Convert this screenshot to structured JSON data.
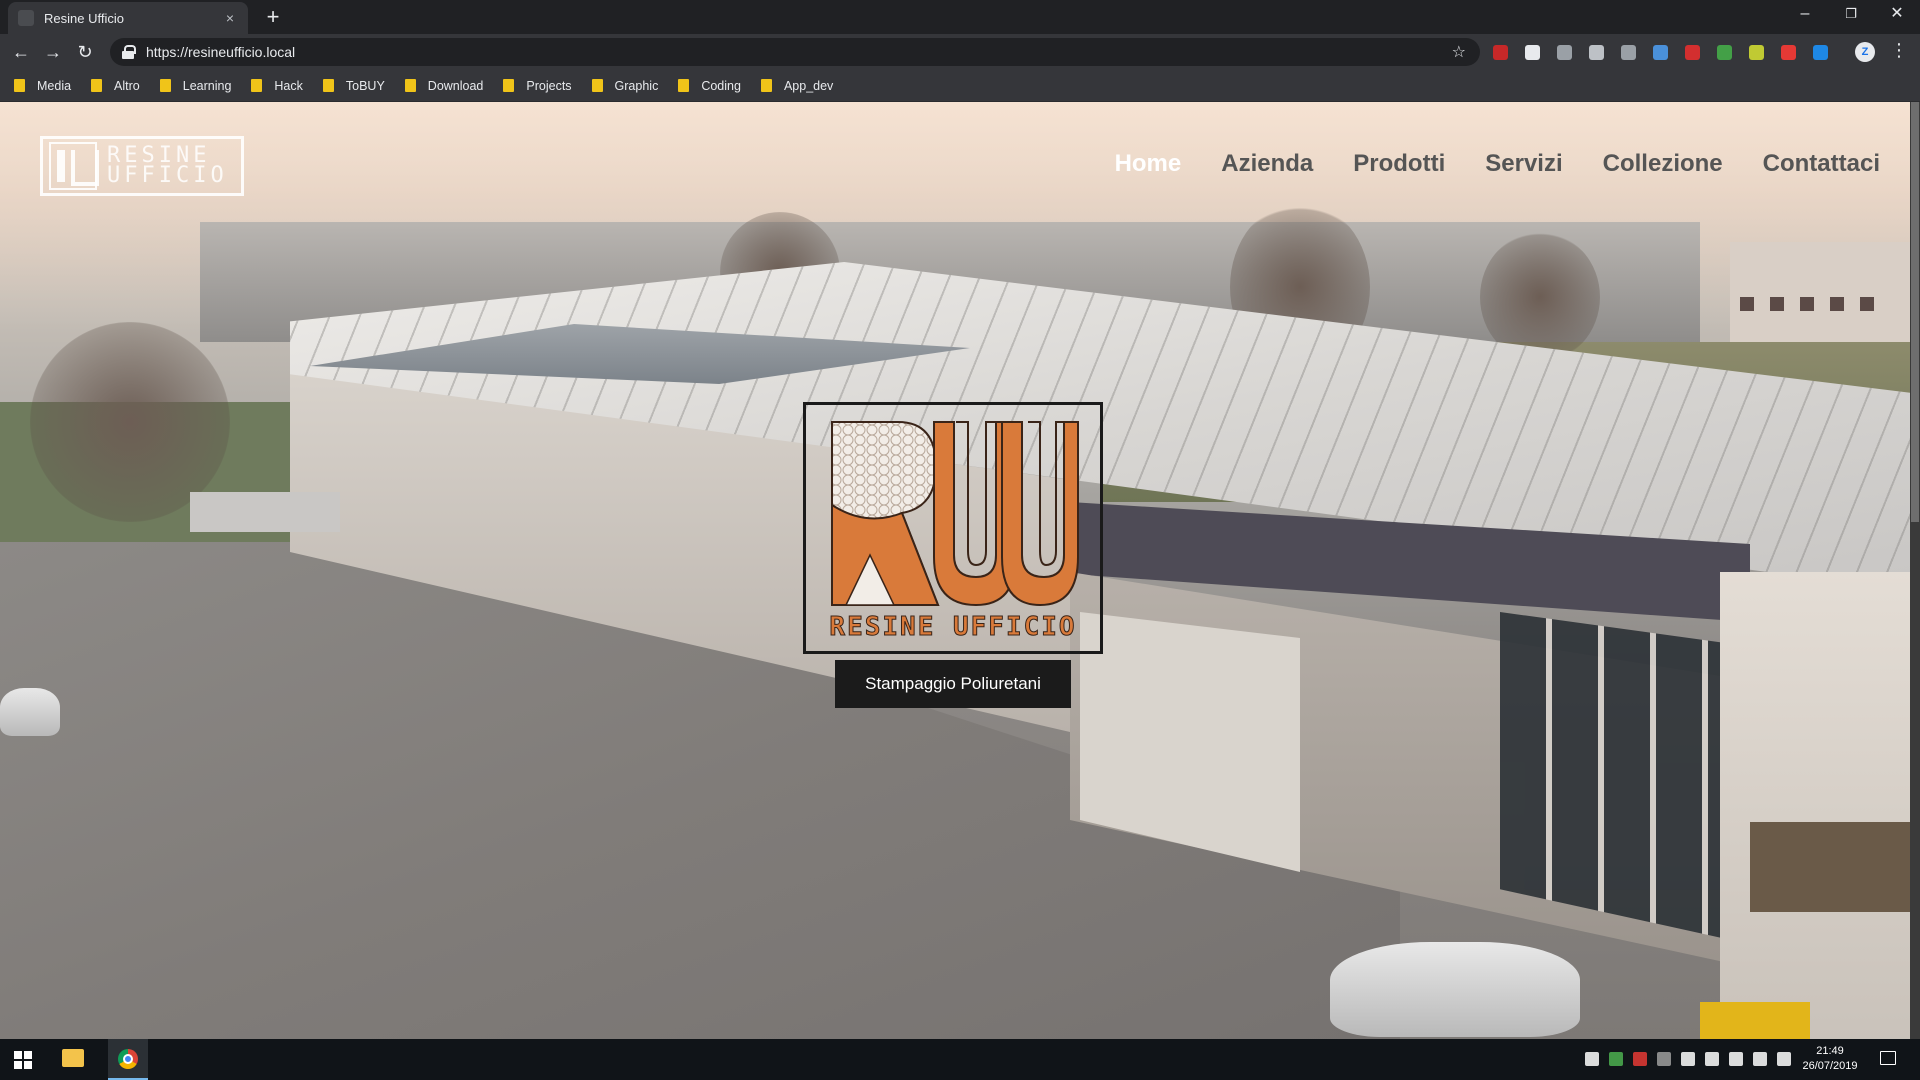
{
  "browser": {
    "tab_title": "Resine Ufficio",
    "tab_close": "×",
    "new_tab": "+",
    "url": "https://resineufficio.local",
    "window_controls": {
      "minimize": "–",
      "restore": "❐",
      "close": "✕"
    },
    "nav": {
      "back": "←",
      "forward": "→",
      "reload": "↻"
    },
    "bookmark_star": "☆",
    "profile_initial": "Z",
    "menu": "⋮",
    "bookmarks": [
      "Media",
      "Altro",
      "Learning",
      "Hack",
      "ToBUY",
      "Download",
      "Projects",
      "Graphic",
      "Coding",
      "App_dev"
    ],
    "extension_colors": [
      "#c62828",
      "#e8eaed",
      "#9aa0a6",
      "#bdc1c6",
      "#9aa0a6",
      "#4a90d9",
      "#d32f2f",
      "#43a047",
      "#c0ca33",
      "#e53935",
      "#1e88e5"
    ]
  },
  "site": {
    "logo_line1": "RESINE",
    "logo_line2": "UFFICIO",
    "nav": [
      {
        "label": "Home",
        "active": true
      },
      {
        "label": "Azienda",
        "active": false
      },
      {
        "label": "Prodotti",
        "active": false
      },
      {
        "label": "Servizi",
        "active": false
      },
      {
        "label": "Collezione",
        "active": false
      },
      {
        "label": "Contattaci",
        "active": false
      }
    ],
    "brand_name": "RESINE UFFICIO",
    "tagline": "Stampaggio Poliuretani",
    "accent_color": "#d97a3a"
  },
  "taskbar": {
    "time": "21:49",
    "date": "26/07/2019",
    "tray_colors": [
      "#ffffff",
      "#4caf50",
      "#e53935",
      "#9e9e9e",
      "#ffffff",
      "#ffffff",
      "#ffffff",
      "#ffffff",
      "#ffffff"
    ]
  }
}
